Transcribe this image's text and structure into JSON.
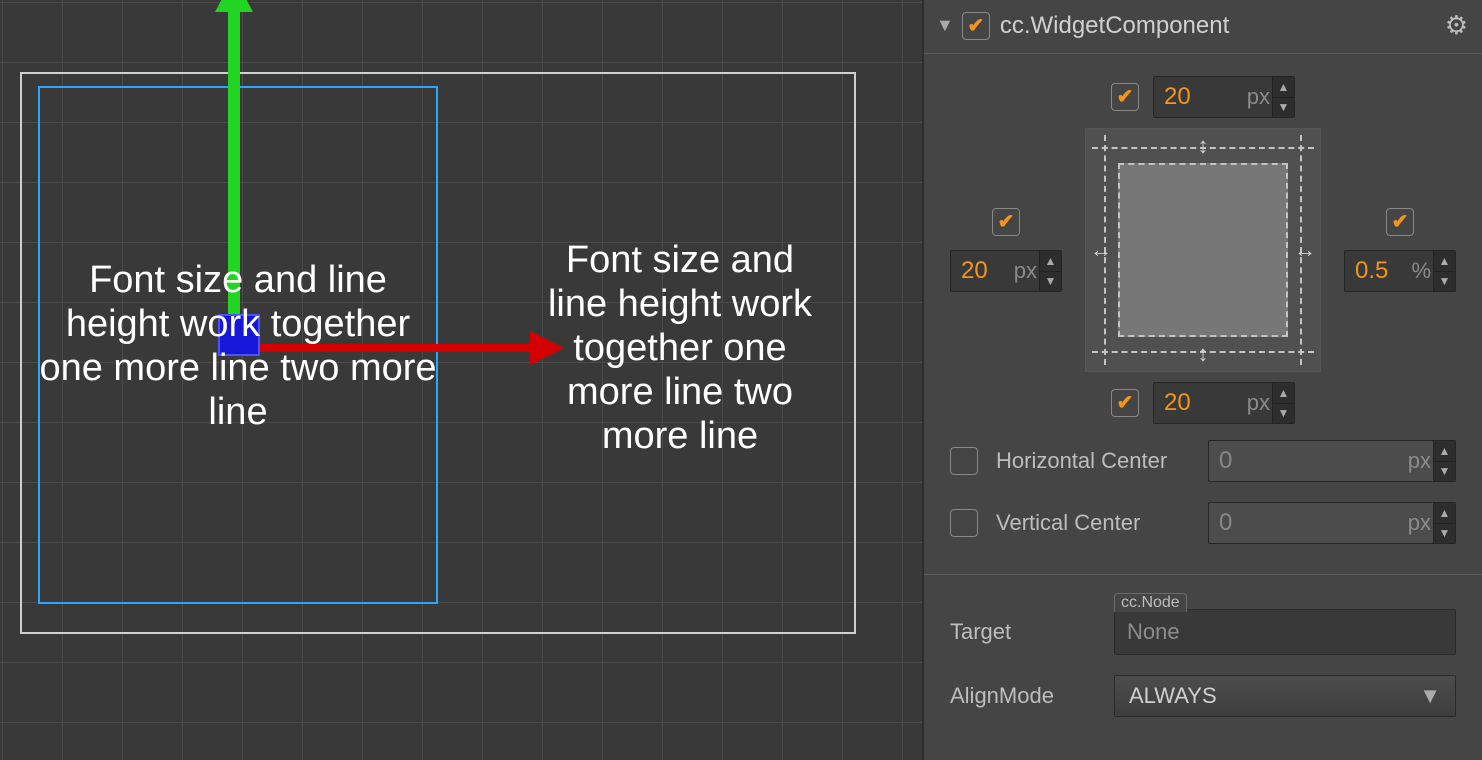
{
  "scene": {
    "text_a": "Font size and line height work together one more line two more line",
    "text_b": "Font size and\nline height work\ntogether one\nmore line two\nmore line"
  },
  "inspector": {
    "header": {
      "enabled": true,
      "title": "cc.WidgetComponent"
    },
    "align": {
      "top": {
        "checked": true,
        "value": "20",
        "unit": "px"
      },
      "bottom": {
        "checked": true,
        "value": "20",
        "unit": "px"
      },
      "left": {
        "checked": true,
        "value": "20",
        "unit": "px"
      },
      "right": {
        "checked": true,
        "value": "0.5",
        "unit": "%"
      }
    },
    "hcenter": {
      "checked": false,
      "label": "Horizontal Center",
      "value": "0",
      "unit": "px"
    },
    "vcenter": {
      "checked": false,
      "label": "Vertical Center",
      "value": "0",
      "unit": "px"
    },
    "target": {
      "label": "Target",
      "tag": "cc.Node",
      "value": "None"
    },
    "alignMode": {
      "label": "AlignMode",
      "value": "ALWAYS"
    }
  }
}
